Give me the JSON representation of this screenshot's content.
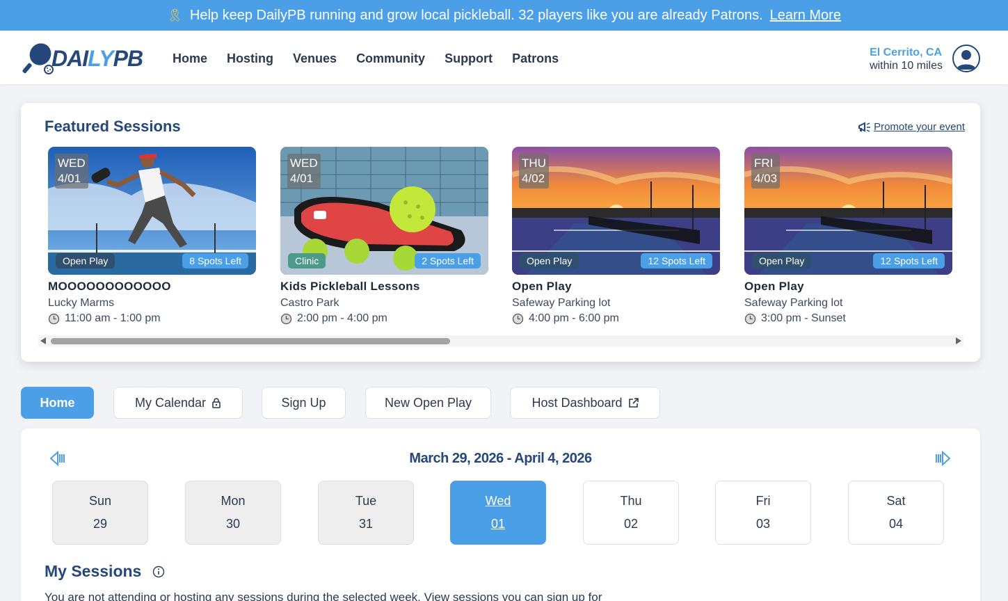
{
  "banner": {
    "message": "Help keep DailyPB running and grow local pickleball. 32 players like you are already Patrons.",
    "link": "Learn More",
    "icon": "ribbon-icon"
  },
  "nav": {
    "logo": {
      "part1": "DAI",
      "part2": "LY",
      "part3": "PB"
    },
    "links": [
      "Home",
      "Hosting",
      "Venues",
      "Community",
      "Support",
      "Patrons"
    ],
    "location_city": "El Cerrito, CA",
    "location_range": "within 10 miles"
  },
  "featured": {
    "title": "Featured Sessions",
    "promote_label": "Promote your event",
    "sessions": [
      {
        "day": "WED",
        "date": "4/01",
        "type": "Open Play",
        "spots": "8 Spots Left",
        "title": "MOOOOOOOOOOOO",
        "venue": "Lucky Marms",
        "time": "11:00 am - 1:00 pm",
        "type_color": "#2f4f6e"
      },
      {
        "day": "WED",
        "date": "4/01",
        "type": "Clinic",
        "spots": "2 Spots Left",
        "title": "Kids Pickleball Lessons",
        "venue": "Castro Park",
        "time": "2:00 pm - 4:00 pm",
        "type_color": "#4e9a8a"
      },
      {
        "day": "THU",
        "date": "4/02",
        "type": "Open Play",
        "spots": "12 Spots Left",
        "title": "Open Play",
        "venue": "Safeway Parking lot",
        "time": "4:00 pm - 6:00 pm",
        "type_color": "#2f4f6e"
      },
      {
        "day": "FRI",
        "date": "4/03",
        "type": "Open Play",
        "spots": "12 Spots Left",
        "title": "Open Play",
        "venue": "Safeway Parking lot",
        "time": "3:00 pm - Sunset",
        "type_color": "#2f4f6e"
      }
    ]
  },
  "tabs": {
    "home": "Home",
    "calendar": "My Calendar",
    "signup": "Sign Up",
    "new_open_play": "New Open Play",
    "host_dashboard": "Host Dashboard"
  },
  "calendar": {
    "week_range": "March 29, 2026 - April 4, 2026",
    "days": [
      {
        "name": "Sun",
        "num": "29",
        "state": "past"
      },
      {
        "name": "Mon",
        "num": "30",
        "state": "past"
      },
      {
        "name": "Tue",
        "num": "31",
        "state": "past"
      },
      {
        "name": "Wed",
        "num": "01",
        "state": "selected"
      },
      {
        "name": "Thu",
        "num": "02",
        "state": "future"
      },
      {
        "name": "Fri",
        "num": "03",
        "state": "future"
      },
      {
        "name": "Sat",
        "num": "04",
        "state": "future"
      }
    ],
    "my_sessions_title": "My Sessions",
    "empty_message": "You are not attending or hosting any sessions during the selected week.  View sessions you can sign up for"
  },
  "colors": {
    "accent": "#4a9fe6",
    "navy": "#25477a",
    "banner": "#4a9fe6"
  }
}
